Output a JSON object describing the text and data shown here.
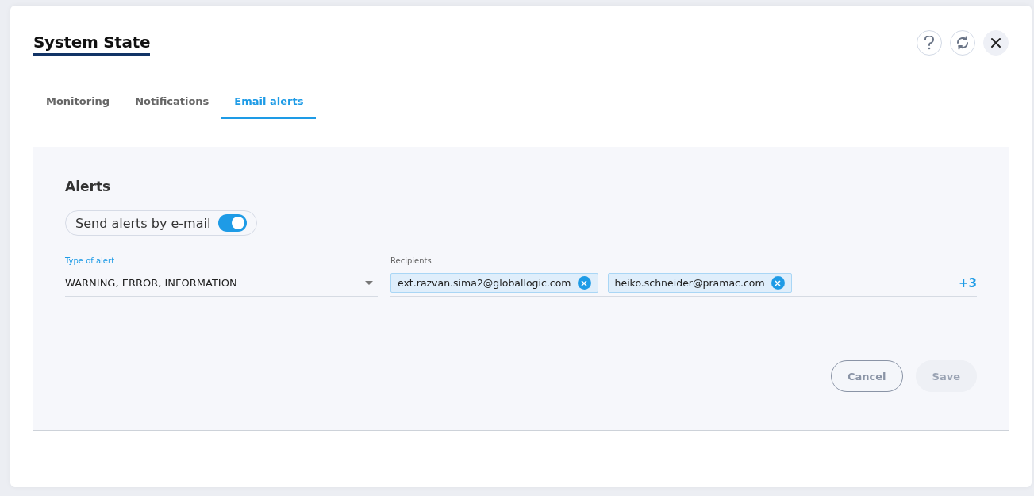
{
  "window": {
    "title": "System State"
  },
  "header_buttons": [
    {
      "kind": "help"
    },
    {
      "kind": "refresh"
    },
    {
      "kind": "close"
    }
  ],
  "tabs": [
    {
      "label": "Monitoring",
      "selected": false
    },
    {
      "label": "Notifications",
      "selected": false
    },
    {
      "label": "Email alerts",
      "selected": true
    }
  ],
  "panel": {
    "title": "Alerts",
    "toggle": {
      "label": "Send alerts by e-mail",
      "on": true
    },
    "type_of_alert": {
      "label": "Type of alert",
      "value": "WARNING, ERROR, INFORMATION"
    },
    "recipients": {
      "label": "Recipients",
      "chips": [
        "ext.razvan.sima2@globallogic.com",
        "heiko.schneider@pramac.com"
      ],
      "more": "+3"
    },
    "buttons": [
      {
        "label": "Cancel",
        "disabled": false
      },
      {
        "label": "Save",
        "disabled": true
      }
    ]
  }
}
